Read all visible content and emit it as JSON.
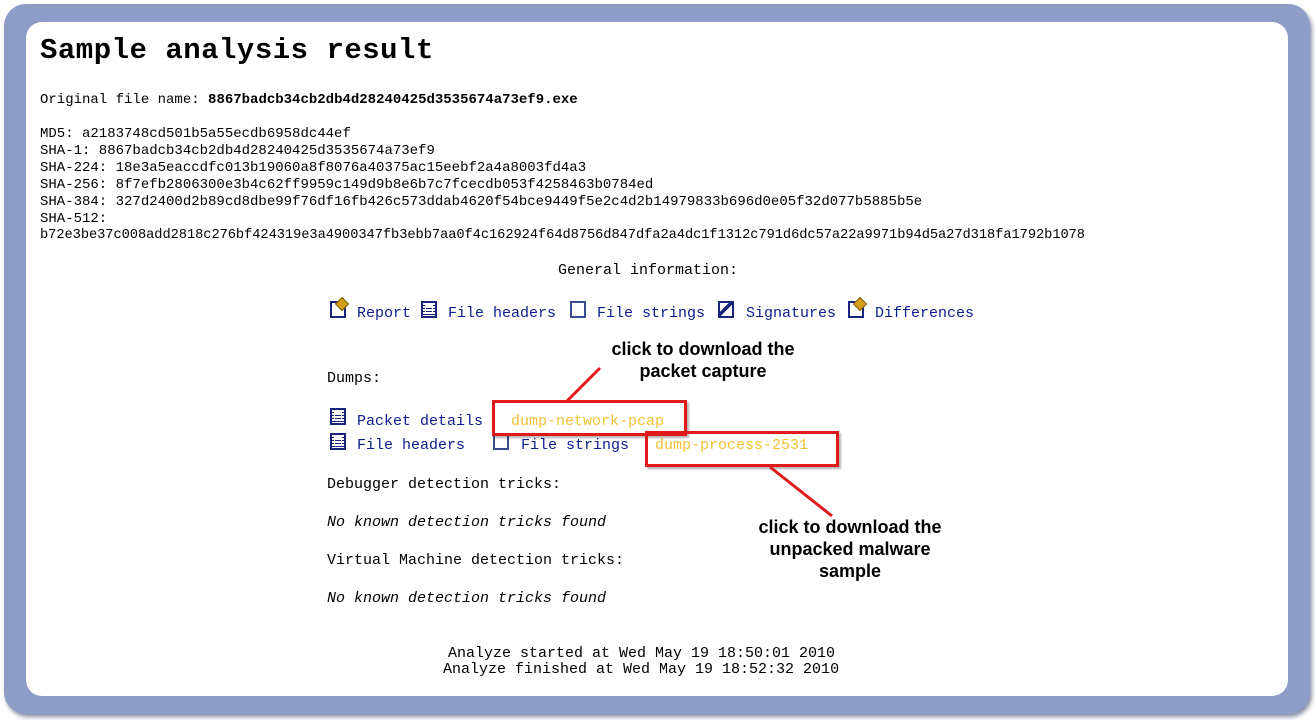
{
  "page": {
    "title": "Sample analysis result",
    "original_file_label": "Original file name:",
    "original_file_name": "8867badcb34cb2db4d28240425d3535674a73ef9.exe",
    "hashes": {
      "md5": "MD5: a2183748cd501b5a55ecdb6958dc44ef",
      "sha1": "SHA-1: 8867badcb34cb2db4d28240425d3535674a73ef9",
      "sha224": "SHA-224: 18e3a5eaccdfc013b19060a8f8076a40375ac15eebf2a4a8003fd4a3",
      "sha256": "SHA-256: 8f7efb2806300e3b4c62ff9959c149d9b8e6b7c7fcecdb053f4258463b0784ed",
      "sha384": "SHA-384: 327d2400d2b89cd8dbe99f76df16fb426c573ddab4620f54bce9449f5e2c4d2b14979833b696d0e05f32d077b5885b5e",
      "sha512_label": "SHA-512:",
      "sha512": "b72e3be37c008add2818c276bf424319e3a4900347fb3ebb7aa0f4c162924f64d8756d847dfa2a4dc1f1312c791d6dc57a22a9971b94d5a27d318fa1792b1078"
    },
    "general_info_label": "General information:",
    "general_links": {
      "report": "Report",
      "file_headers": "File headers",
      "file_strings": "File strings",
      "signatures": "Signatures",
      "differences": "Differences"
    },
    "dumps_label": "Dumps:",
    "dump_links": {
      "packet_details": "Packet details",
      "network_pcap": "dump-network-pcap",
      "file_headers": "File headers",
      "file_strings": "File strings",
      "process": "dump-process-2531"
    },
    "debugger_label": "Debugger detection tricks:",
    "debugger_result": "No known detection tricks found",
    "vm_label": "Virtual Machine detection tricks:",
    "vm_result": "No known detection tricks found",
    "started": "Analyze started at Wed May 19 18:50:01 2010",
    "finished": "Analyze finished at Wed May 19 18:52:32 2010"
  },
  "annotations": {
    "pcap_callout": [
      "click to download the",
      "packet capture"
    ],
    "malware_callout": [
      "click to download the",
      "unpacked malware",
      "sample"
    ],
    "highlight_color": "#e01b1b"
  },
  "colors": {
    "frame": "#8e9cc8",
    "link": "#0b1d8f",
    "dump_link": "#f1c232"
  },
  "icons": {
    "report": "edit-icon",
    "file_headers": "document-lines-icon",
    "file_strings": "blank-document-icon",
    "signatures": "signature-icon",
    "differences": "edit-icon"
  }
}
